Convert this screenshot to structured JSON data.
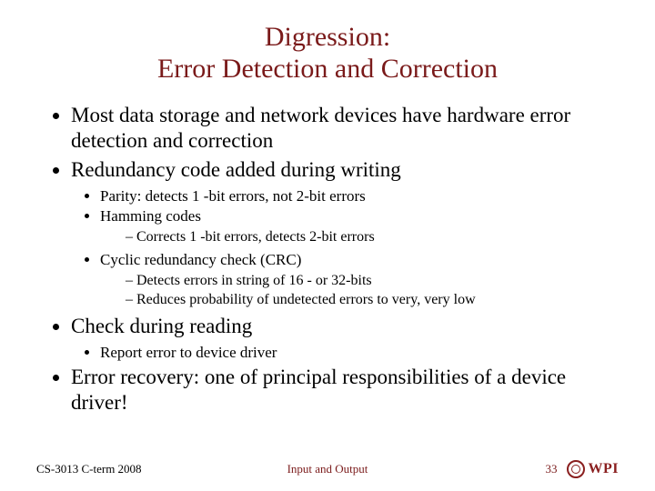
{
  "title_line1": "Digression:",
  "title_line2": "Error Detection and Correction",
  "bullets": {
    "b1": "Most data storage and network devices have hardware error detection and correction",
    "b2": "Redundancy code added during writing",
    "b2_sub1": "Parity: detects 1 -bit errors, not 2-bit errors",
    "b2_sub2": "Hamming codes",
    "b2_sub2_d1": "Corrects 1 -bit errors, detects 2-bit errors",
    "b2_sub3": "Cyclic redundancy check (CRC)",
    "b2_sub3_d1": "Detects errors in string of 16 - or 32-bits",
    "b2_sub3_d2": "Reduces probability of undetected errors to very, very low",
    "b3": "Check during reading",
    "b3_sub1": "Report error to device driver",
    "b4": "Error recovery: one of principal responsibilities of a device driver!"
  },
  "footer": {
    "left": "CS-3013 C-term 2008",
    "center": "Input and Output",
    "page": "33",
    "logo_text": "WPI"
  }
}
